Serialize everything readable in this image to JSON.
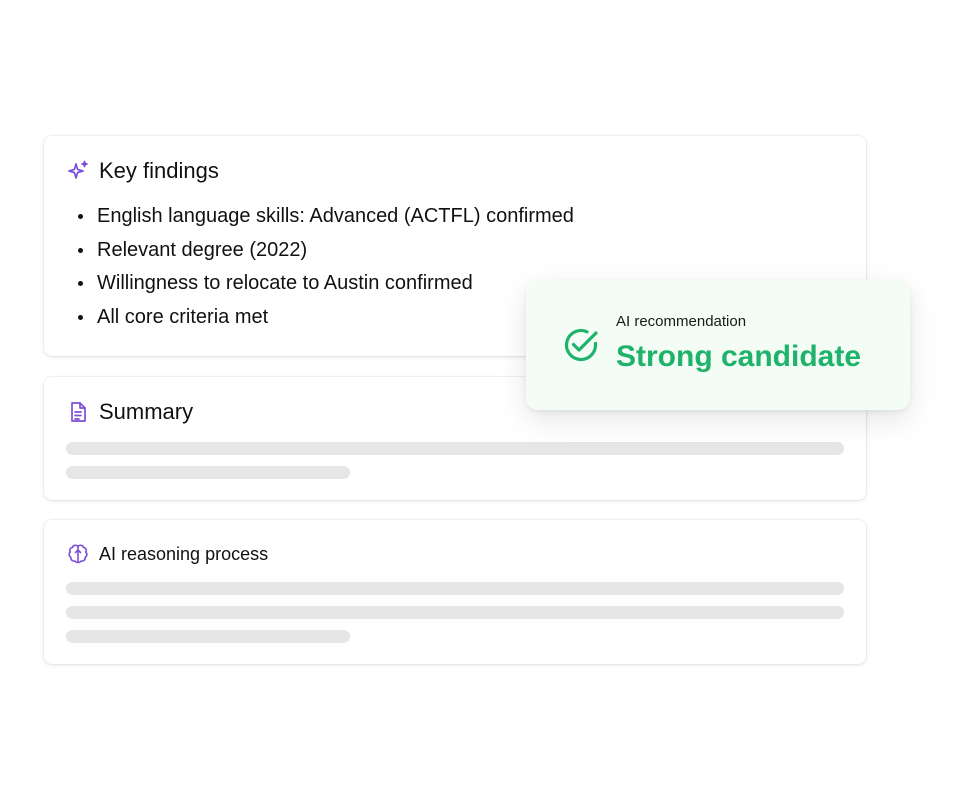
{
  "key_findings": {
    "icon": "sparkles-icon",
    "title": "Key findings",
    "items": [
      "English language skills: Advanced (ACTFL) confirmed",
      "Relevant degree (2022)",
      "Willingness to relocate to Austin confirmed",
      "All core criteria met"
    ]
  },
  "summary": {
    "icon": "document-icon",
    "title": "Summary"
  },
  "reasoning": {
    "icon": "brain-icon",
    "title": "AI reasoning process"
  },
  "recommendation": {
    "icon": "check-circle-icon",
    "label": "AI recommendation",
    "value": "Strong candidate"
  },
  "colors": {
    "accent_purple": "#7b4fd6",
    "success_green": "#1fb26a",
    "recommendation_bg": "#f3fcf5",
    "skeleton_gray": "#e6e6e6"
  }
}
